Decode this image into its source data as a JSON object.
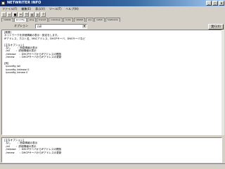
{
  "window": {
    "title": "NETWRITER INFO",
    "min": "_",
    "max": "□",
    "close": "×"
  },
  "menu": [
    "ファイル(F)",
    "編集(E)",
    "表示(V)",
    "ツール(T)",
    "ヘルプ(H)"
  ],
  "toolbar_icons": [
    "new-icon",
    "open-icon",
    "save-icon",
    "cut-icon",
    "copy-icon",
    "paste-icon",
    "find-icon",
    "help-icon"
  ],
  "tabs": [
    "netstat",
    "ipconfig",
    "ping",
    "tracert",
    "nslookup",
    "route",
    "nbtstat",
    "arp",
    "netsh",
    "hostname"
  ],
  "option": {
    "label": "オプション",
    "value": "/all",
    "dropdown": "▼",
    "run": "実行(X)"
  },
  "output_lines": [
    "[概要]",
    "ネットワークを詳細情報の表示・設定をします。",
    "IPアドレス、ホスト名、MACアドレス、DHCPサーバ、DNSサーバなど",
    "",
    "[主なオプション]",
    "  なし        ：簡易情報の表示",
    "  /all        ：詳細情報の表示",
    "  /release    ：DHCPサーバからIPアドレスの開放",
    "  /renew      ：DHCPサーバからIPアドレスの更新",
    "",
    "[例]",
    "  ipconfig /all",
    "  ipconfig /release 0",
    "  ipconfig /renew 0"
  ],
  "bottom_lines": [
    "[主なオプション]",
    "  なし        ：簡易情報の表示",
    "  /all        ：詳細情報の表示",
    "  /release    ：DHCPサーバからIPアドレスの開放",
    "  /renew      ：DHCPサーバからIPアドレスの更新"
  ]
}
